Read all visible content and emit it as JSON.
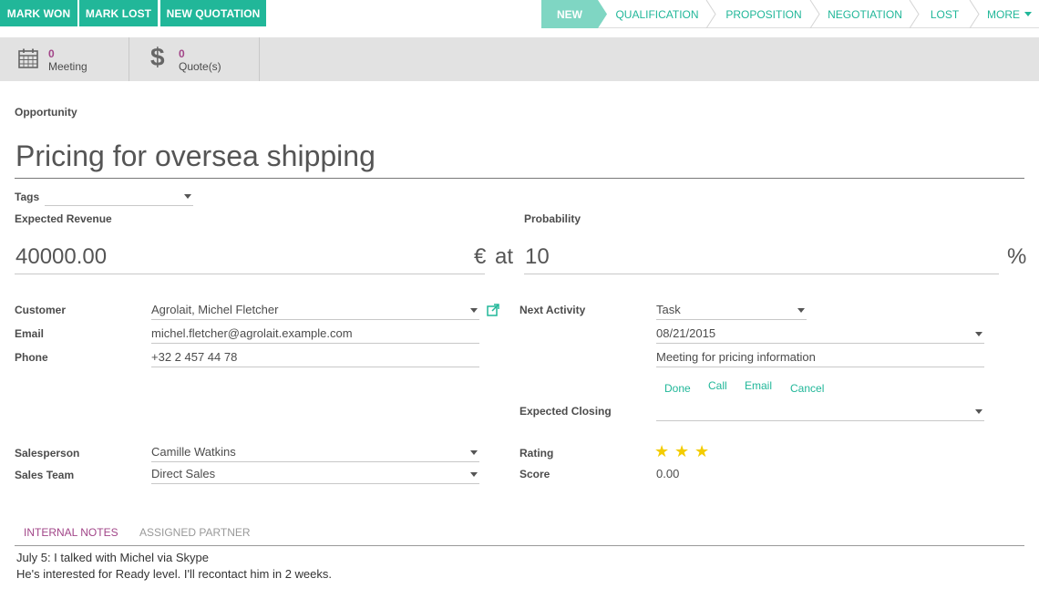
{
  "actions": {
    "mark_won": "MARK WON",
    "mark_lost": "MARK LOST",
    "new_quotation": "NEW QUOTATION"
  },
  "stages": [
    "NEW",
    "QUALIFICATION",
    "PROPOSITION",
    "NEGOTIATION",
    "LOST",
    "MORE"
  ],
  "stage_active": "NEW",
  "stats": {
    "meeting": {
      "count": "0",
      "label": "Meeting",
      "icon": "calendar-icon"
    },
    "quotes": {
      "count": "0",
      "label": "Quote(s)",
      "icon": "dollar-icon"
    }
  },
  "form": {
    "section_label": "Opportunity",
    "title": "Pricing for oversea shipping",
    "tags_label": "Tags",
    "tags_value": "",
    "expected_revenue_label": "Expected Revenue",
    "expected_revenue": "40000.00",
    "currency_symbol": "€",
    "at_text": "at",
    "probability_label": "Probability",
    "probability": "10",
    "percent_symbol": "%",
    "customer_label": "Customer",
    "customer": "Agrolait, Michel Fletcher",
    "email_label": "Email",
    "email": "michel.fletcher@agrolait.example.com",
    "phone_label": "Phone",
    "phone": "+32 2 457 44 78",
    "next_activity_label": "Next Activity",
    "next_activity": "Task",
    "next_activity_date": "08/21/2015",
    "next_activity_summary": "Meeting for pricing information",
    "activity_actions": {
      "done": "Done",
      "call": "Call",
      "email": "Email",
      "cancel": "Cancel"
    },
    "expected_closing_label": "Expected Closing",
    "expected_closing": "",
    "salesperson_label": "Salesperson",
    "salesperson": "Camille Watkins",
    "sales_team_label": "Sales Team",
    "sales_team": "Direct Sales",
    "rating_label": "Rating",
    "rating_stars": 3,
    "score_label": "Score",
    "score": "0.00"
  },
  "tabs": {
    "internal_notes": "INTERNAL NOTES",
    "assigned_partner": "ASSIGNED PARTNER",
    "active": "internal_notes"
  },
  "notes": {
    "line1": "July 5: I talked with Michel via Skype",
    "line2": "He's interested for Ready level. I'll recontact him in 2 weeks."
  },
  "colors": {
    "accent": "#21b799",
    "active_stage": "#7fd6c3",
    "stat_count": "#a24689",
    "tab_active": "#a24689",
    "star": "#f3cc00"
  }
}
